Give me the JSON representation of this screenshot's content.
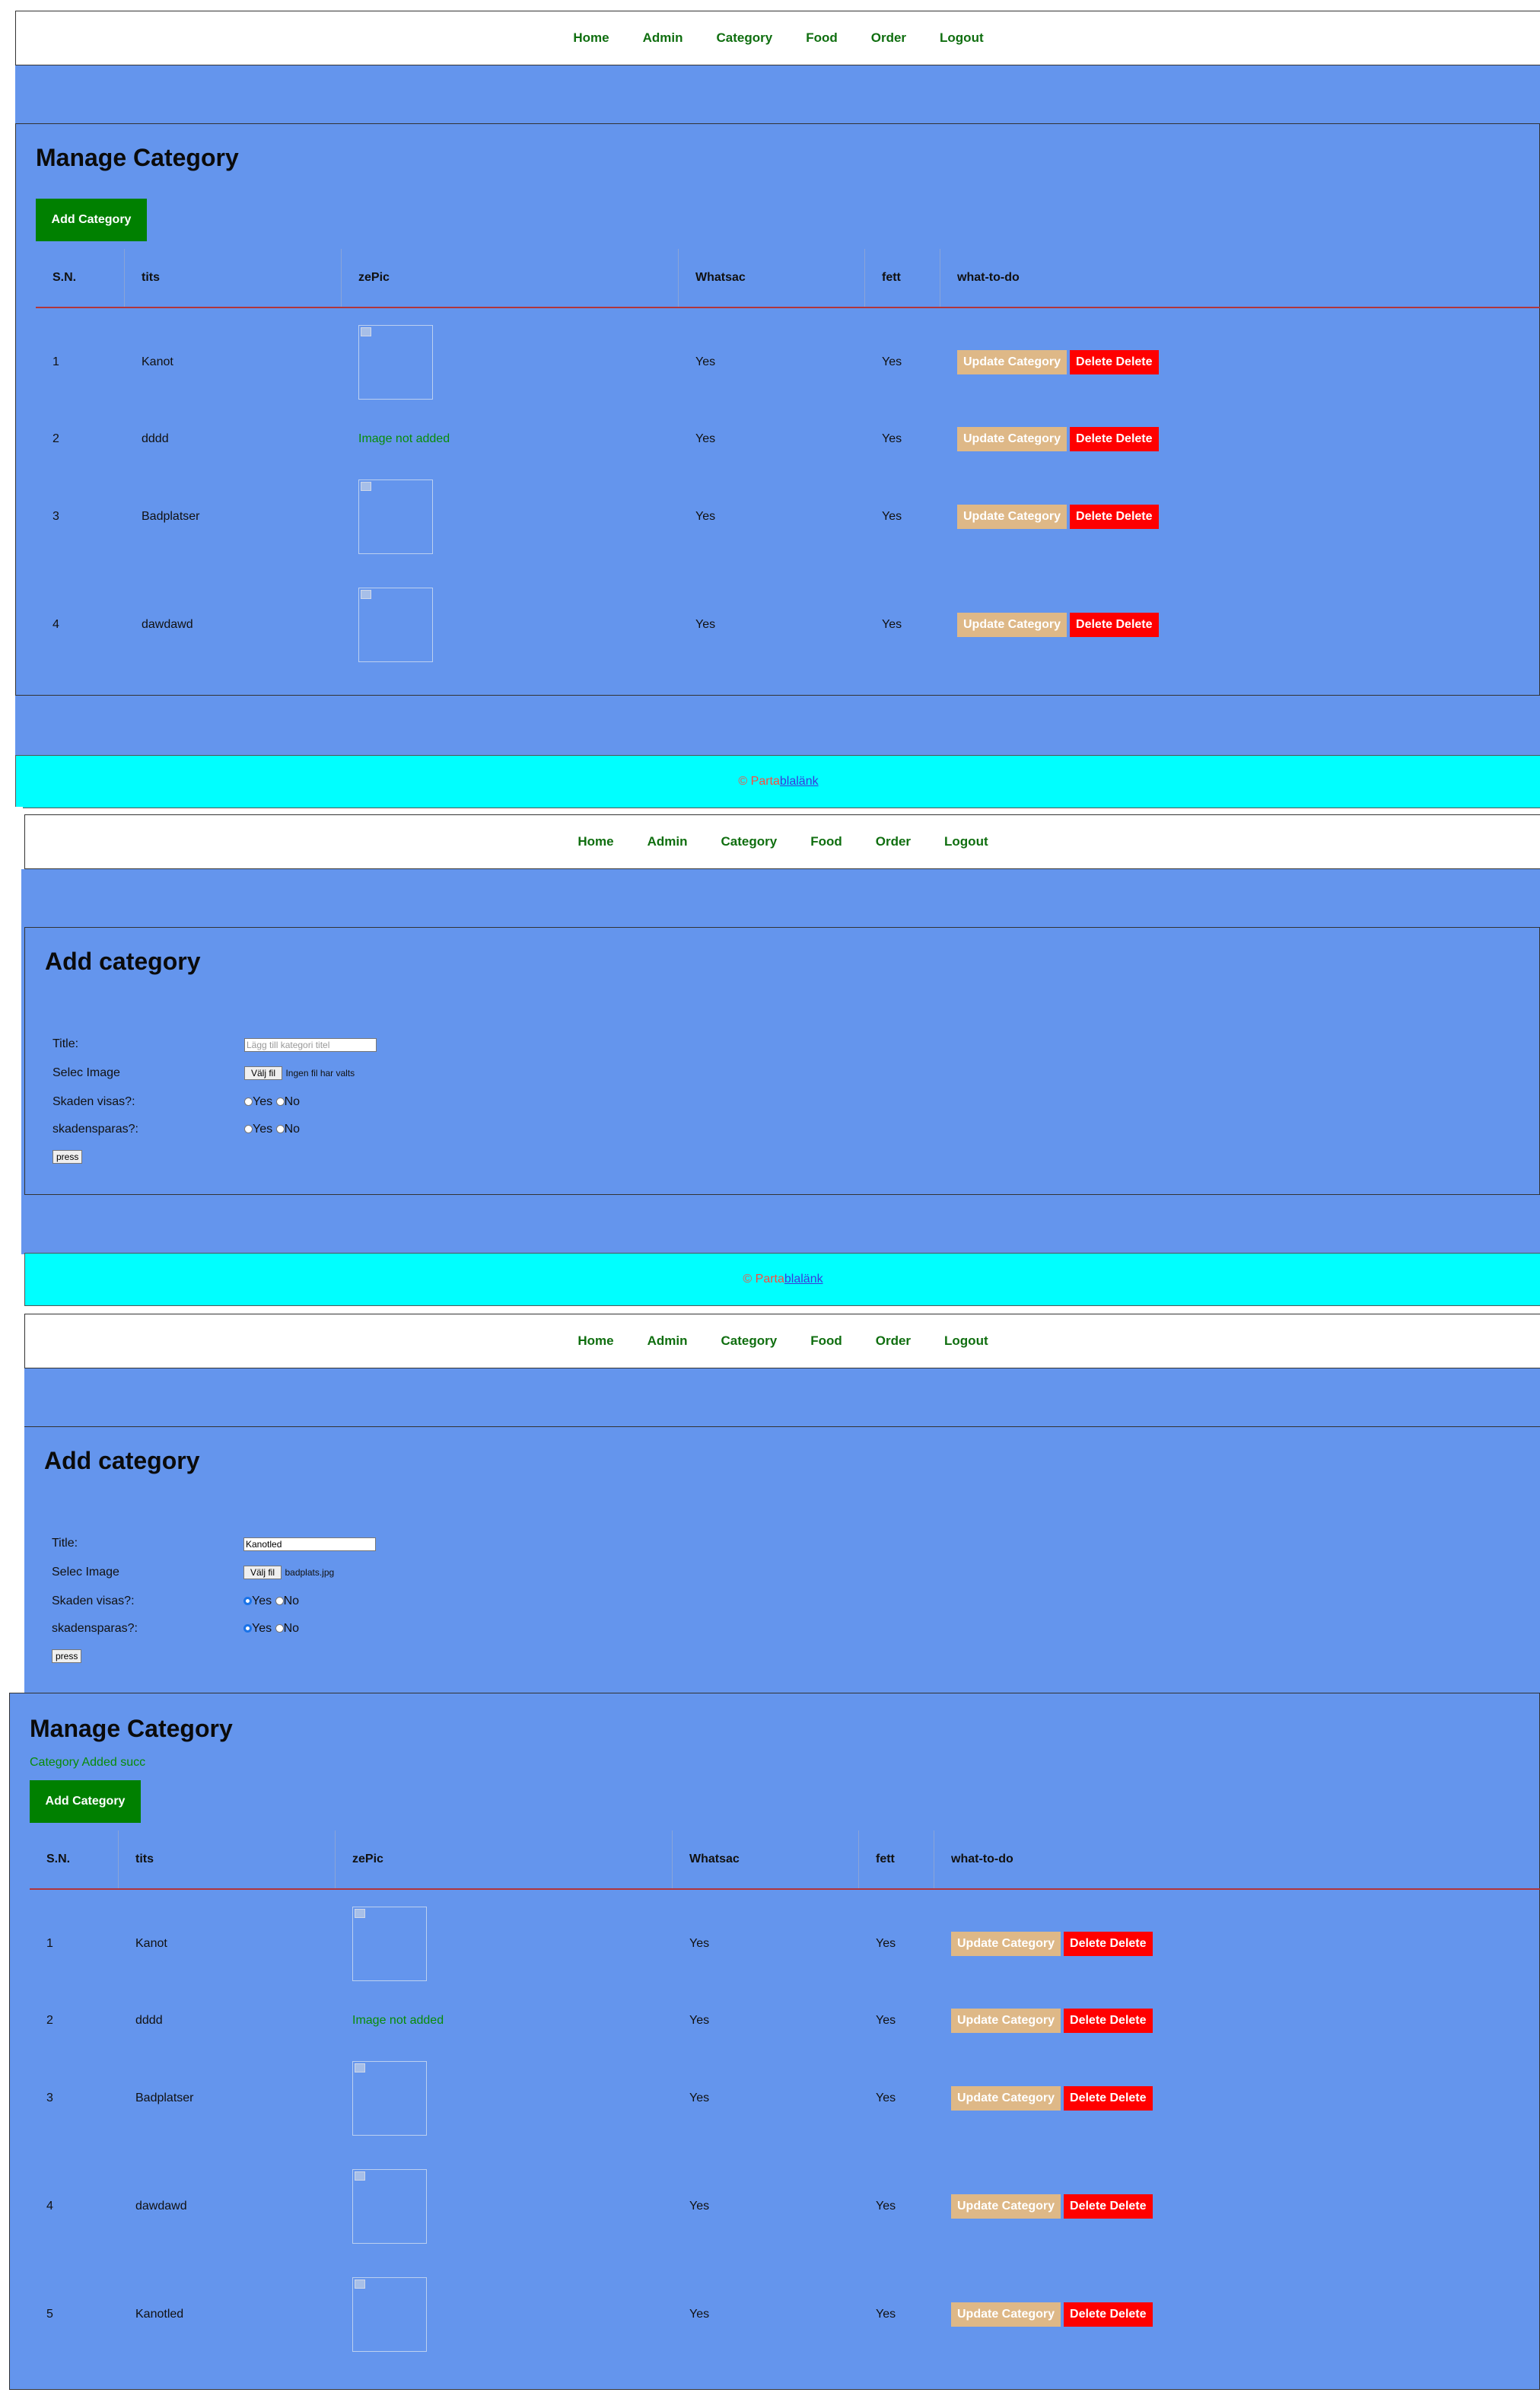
{
  "nav": {
    "home": "Home",
    "admin": "Admin",
    "category": "Category",
    "food": "Food",
    "order": "Order",
    "logout": "Logout"
  },
  "manage": {
    "title": "Manage Category",
    "add_button": "Add Category",
    "success_message": "Category Added succ"
  },
  "table": {
    "headers": [
      "S.N.",
      "tits",
      "zePic",
      "Whatsac",
      "fett",
      "what-to-do"
    ],
    "update_label": "Update Category",
    "delete_label": "Delete Delete",
    "image_missing": "Image not added",
    "rows": [
      {
        "sn": "1",
        "title": "Kanot",
        "image": true,
        "featured": "Yes",
        "active": "Yes"
      },
      {
        "sn": "2",
        "title": "dddd",
        "image": false,
        "featured": "Yes",
        "active": "Yes"
      },
      {
        "sn": "3",
        "title": "Badplatser",
        "image": true,
        "featured": "Yes",
        "active": "Yes"
      },
      {
        "sn": "4",
        "title": "dawdawd",
        "image": true,
        "featured": "Yes",
        "active": "Yes"
      },
      {
        "sn": "5",
        "title": "Kanotled",
        "image": true,
        "featured": "Yes",
        "active": "Yes"
      }
    ]
  },
  "footer": {
    "copyright": "© Parta",
    "link": "blalänk"
  },
  "add_form": {
    "title": "Add category",
    "title_label": "Title:",
    "title_placeholder": "Lägg till kategori titel",
    "title_value_filled": "Kanotled",
    "image_label": "Selec Image",
    "file_button": "Välj fil",
    "no_file": "Ingen fil har valts",
    "chosen_file": "badplats.jpg",
    "featured_label": "Skaden visas?:",
    "active_label": "skadensparas?:",
    "yes": "Yes",
    "no": "No",
    "submit": "press"
  },
  "colors": {
    "panel_bg": "#6495ed",
    "nav_link": "#0f6e0f",
    "add_btn": "#008000",
    "update_btn": "#deb887",
    "delete_btn": "#ff0000",
    "footer_bg": "#00ffff"
  }
}
